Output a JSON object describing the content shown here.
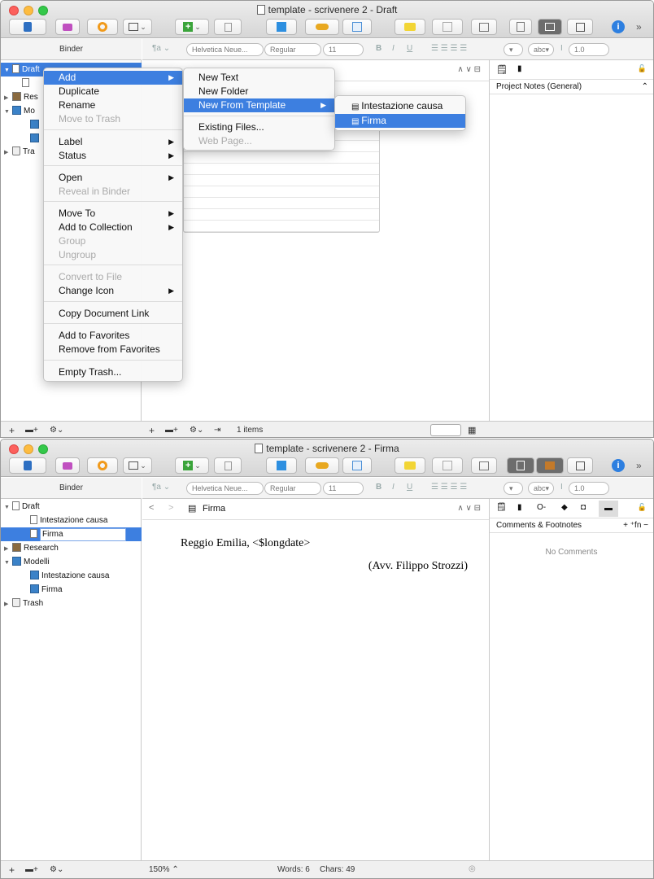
{
  "w1": {
    "title": "template - scrivenere 2 - Draft",
    "binder_label": "Binder",
    "format": {
      "font": "Helvetica Neue...",
      "style": "Regular",
      "size": "11",
      "spacing": "1.0"
    },
    "tree": [
      {
        "label": "Draft",
        "selected": true
      },
      {
        "label": "Res"
      },
      {
        "label": "Mo"
      },
      {
        "label": "Tra"
      }
    ],
    "inspector_title": "Project Notes (General)",
    "bottom_status": "1 items",
    "context_menu": [
      {
        "label": "Add",
        "submenu": true,
        "highlighted": true
      },
      {
        "label": "Duplicate"
      },
      {
        "label": "Rename"
      },
      {
        "label": "Move to Trash",
        "disabled": true
      },
      {
        "label": "Label",
        "submenu": true
      },
      {
        "label": "Status",
        "submenu": true
      },
      {
        "label": "Open",
        "submenu": true
      },
      {
        "label": "Reveal in Binder",
        "disabled": true
      },
      {
        "label": "Move To",
        "submenu": true
      },
      {
        "label": "Add to Collection",
        "submenu": true
      },
      {
        "label": "Group",
        "disabled": true
      },
      {
        "label": "Ungroup",
        "disabled": true
      },
      {
        "label": "Convert to File",
        "disabled": true
      },
      {
        "label": "Change Icon",
        "submenu": true
      },
      {
        "label": "Copy Document Link"
      },
      {
        "label": "Add to Favorites"
      },
      {
        "label": "Remove from Favorites"
      },
      {
        "label": "Empty Trash..."
      }
    ],
    "add_submenu": [
      {
        "label": "New Text"
      },
      {
        "label": "New Folder"
      },
      {
        "label": "New From Template",
        "submenu": true,
        "highlighted": true
      },
      {
        "label": "Existing Files..."
      },
      {
        "label": "Web Page...",
        "disabled": true
      }
    ],
    "template_submenu": [
      {
        "label": "Intestazione causa"
      },
      {
        "label": "Firma",
        "highlighted": true
      }
    ]
  },
  "w2": {
    "title": "template - scrivenere 2 - Firma",
    "binder_label": "Binder",
    "format": {
      "font": "Helvetica Neue...",
      "style": "Regular",
      "size": "11",
      "spacing": "1.0"
    },
    "tree": [
      {
        "label": "Draft"
      },
      {
        "label": "Intestazione causa"
      },
      {
        "label": "Firma",
        "selected": true
      },
      {
        "label": "Research"
      },
      {
        "label": "Modelli"
      },
      {
        "label": "Intestazione causa"
      },
      {
        "label": "Firma"
      },
      {
        "label": "Trash"
      }
    ],
    "editor_header_title": "Firma",
    "doc_line1": "Reggio Emilia, <$longdate>",
    "doc_line2": "(Avv. Filippo Strozzi)",
    "inspector_title": "Comments & Footnotes",
    "no_comments": "No Comments",
    "zoom": "150%",
    "word_count": "Words: 6",
    "char_count": "Chars: 49"
  }
}
